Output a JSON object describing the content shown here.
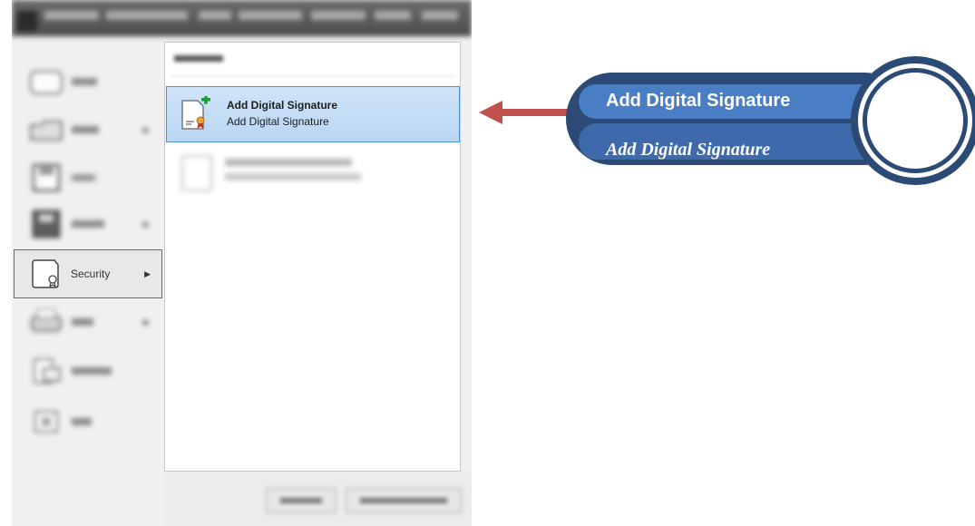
{
  "menu": {
    "active_item": {
      "label": "Security",
      "icon": "security-document-icon",
      "has_submenu": true
    }
  },
  "panel": {
    "selected_item": {
      "title": "Add Digital Signature",
      "subtitle": "Add Digital Signature",
      "icon": "add-signature-icon"
    }
  },
  "callout": {
    "title": "Add Digital Signature",
    "subtitle": "Add Digital Signature"
  },
  "colors": {
    "callout_dark": "#2b4a75",
    "callout_band": "#4a7ec4",
    "arrow": "#c0504d",
    "selection": "#b9d6f3"
  }
}
